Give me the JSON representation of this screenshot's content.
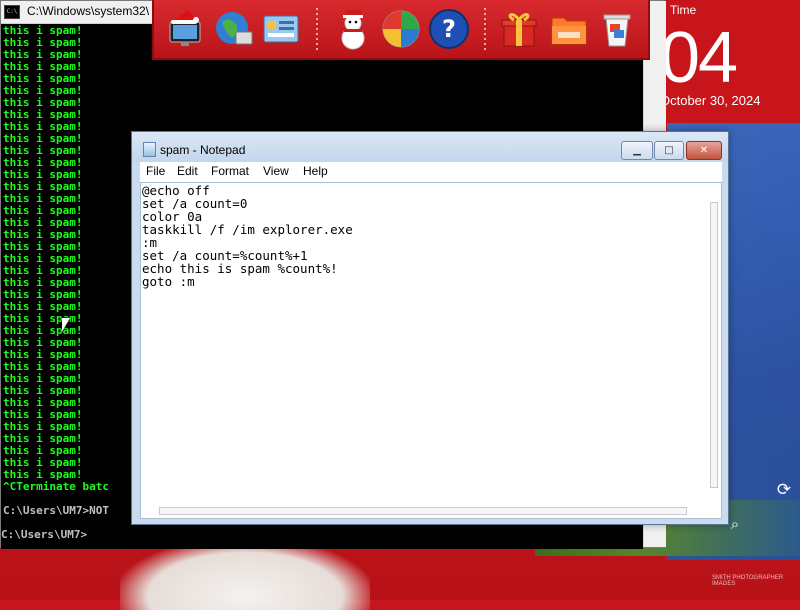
{
  "desktop": {
    "time_tile_label": "Time",
    "time_day": "04",
    "time_date": "October 30, 2024",
    "refresh_icon": "refresh-icon",
    "search_icon": "search-icon",
    "watermark": "SMITH PHOTOGRAPHER IMAGES"
  },
  "console": {
    "title": "C:\\Windows\\system32\\",
    "spam_line": "this i spam!",
    "terminate_line": "^CTerminate batc",
    "prompt_line_1": "C:\\Users\\UM7>NOT",
    "prompt_line_2": "C:\\Users\\UM7>"
  },
  "toolbar": {
    "icons": [
      "computer-santa-hat-icon",
      "internet-globe-icon",
      "control-panel-icon",
      "snowman-icon",
      "windows-update-icon",
      "help-icon",
      "gift-box-icon",
      "folder-icon",
      "recycle-bin-icon"
    ]
  },
  "notepad": {
    "title": "spam - Notepad",
    "minimize_label": "▁",
    "maximize_label": "□",
    "close_label": "✕",
    "menu": [
      "File",
      "Edit",
      "Format",
      "View",
      "Help"
    ],
    "content_lines": [
      "@echo off",
      "set /a count=0",
      "color 0a",
      "taskkill /f /im explorer.exe",
      ":m",
      "set /a count=%count%+1",
      "echo this is spam %count%!",
      "goto :m"
    ]
  },
  "colors": {
    "console_text": "#1cff1c",
    "console_bg": "#000000",
    "desktop_red": "#c4161c",
    "tile_blue": "#3562b8"
  }
}
